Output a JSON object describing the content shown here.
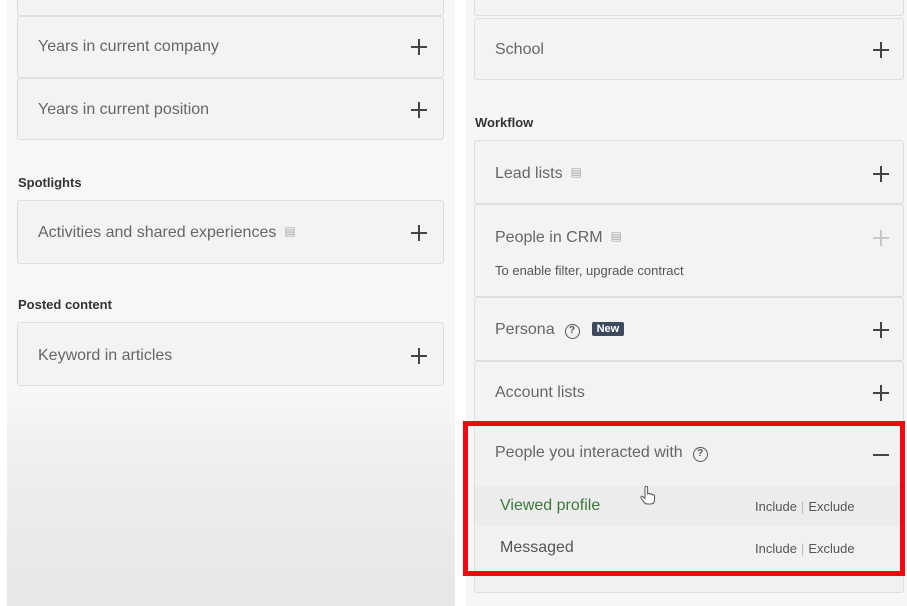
{
  "left": {
    "rows_top": [
      {
        "label": "Years in current company"
      },
      {
        "label": "Years in current position"
      }
    ],
    "spotlights": {
      "title": "Spotlights",
      "item": "Activities and shared experiences"
    },
    "posted_content": {
      "title": "Posted content",
      "item": "Keyword in articles"
    }
  },
  "right": {
    "school": "School",
    "workflow_title": "Workflow",
    "lead_lists": "Lead lists",
    "people_in_crm": "People in CRM",
    "crm_note": "To enable filter, upgrade contract",
    "persona": "Persona",
    "persona_badge": "New",
    "account_lists": "Account lists",
    "interacted": "People you interacted with",
    "options": [
      {
        "label": "Viewed profile",
        "include": "Include",
        "exclude": "Exclude"
      },
      {
        "label": "Messaged",
        "include": "Include",
        "exclude": "Exclude"
      }
    ]
  },
  "icons": {
    "pin": "pin-icon",
    "help": "question-circle-icon",
    "plus": "plus-icon",
    "minus": "minus-icon"
  },
  "colors": {
    "highlight": "#f2070f",
    "viewed_profile_text": "#3a7a3a",
    "badge": "#3d4a5c"
  }
}
